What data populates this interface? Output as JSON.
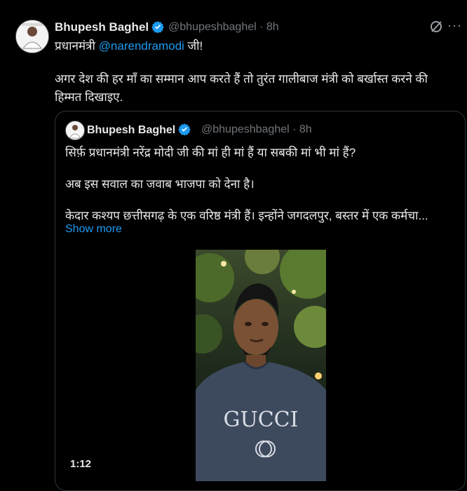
{
  "tweet": {
    "author_name": "Bhupesh Baghel",
    "author_handle": "@bhupeshbaghel · 8h",
    "line1_prefix": "प्रधानमंत्री ",
    "mention": "@narendramodi",
    "line1_suffix": " जी!",
    "body": "अगर देश की हर माँ का सम्मान आप करते हैं तो तुरंत गालीबाज मंत्री को बर्खास्त करने की हिम्मत दिखाइए.",
    "more_label": "···"
  },
  "quoted": {
    "author_name": "Bhupesh Baghel",
    "author_handle": "@bhupeshbaghel · 8h",
    "line1": "सिर्फ़ प्रधानमंत्री नरेंद्र मोदी जी की मां ही मां हैं या सबकी मां भी मां हैं?",
    "line2": "अब इस सवाल का जवाब भाजपा को देना है।",
    "line3": "केदार कश्यप छत्तीसगढ़ के एक वरिष्ठ मंत्री हैं। इन्होंने जगदलपुर, बस्तर में एक कर्मचा...",
    "show_more": "Show more",
    "video_duration": "1:12",
    "shirt_text": "GUCCI"
  },
  "colors": {
    "background": "#000000",
    "text": "#e7e9ea",
    "secondary": "#71767b",
    "link": "#1d9bf0",
    "border": "#2f3336"
  }
}
